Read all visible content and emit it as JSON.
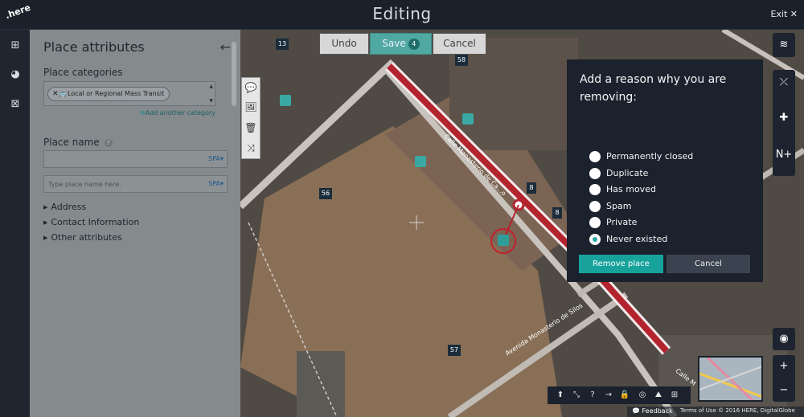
{
  "app": {
    "logo": ".here",
    "title": "Editing",
    "exit_label": "Exit",
    "exit_icon": "close-icon"
  },
  "rail": {
    "items": [
      "layers-grid-icon",
      "palette-icon",
      "map-edit-icon"
    ]
  },
  "panel": {
    "title": "Place attributes",
    "back_icon": "arrow-left-icon",
    "categories_label": "Place categories",
    "category_chip": "Local or Regional Mass Transit",
    "add_category": "Add another category",
    "place_name_label": "Place name",
    "name_value": "",
    "lang_1": "SPA",
    "placeholder": "Type place name here.",
    "lang_2": "SPA",
    "sections": [
      "Address",
      "Contact Information",
      "Other attributes"
    ]
  },
  "toolbar": {
    "undo": "Undo",
    "save": "Save",
    "save_count": "4",
    "cancel": "Cancel"
  },
  "map": {
    "block_numbers": [
      "13",
      "58",
      "56",
      "8",
      "8",
      "57"
    ],
    "street_1": "Calle Monasterio de Ca...o",
    "street_2": "Avenida Monasterio de Silos",
    "street_3": "Calle M"
  },
  "dialog": {
    "heading": "Add a reason why you are removing:",
    "options": [
      {
        "label": "Permanently closed",
        "selected": false
      },
      {
        "label": "Duplicate",
        "selected": false
      },
      {
        "label": "Has moved",
        "selected": false
      },
      {
        "label": "Spam",
        "selected": false
      },
      {
        "label": "Private",
        "selected": false
      },
      {
        "label": "Never existed",
        "selected": true
      }
    ],
    "remove": "Remove place",
    "cancel": "Cancel"
  },
  "footer": {
    "feedback": "Feedback",
    "terms": "Terms of Use © 2016 HERE, DigitalGlobe"
  },
  "colors": {
    "accent": "#17a39c",
    "panel": "#858a8d",
    "dark": "#1b222d",
    "road_red": "#b3242e"
  }
}
